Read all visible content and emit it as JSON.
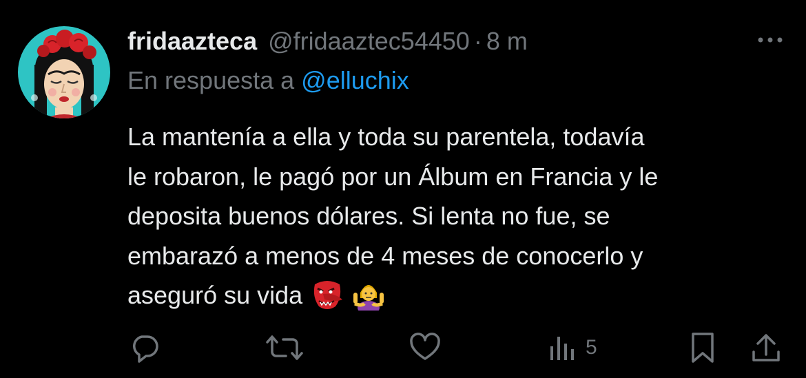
{
  "tweet": {
    "display_name": "fridaazteca",
    "handle": "@fridaaztec54450",
    "separator": "·",
    "time": "8 m",
    "reply_prefix": "En respuesta a",
    "reply_mention": "@elluchix",
    "text": "La mantenía a ella y toda su parentela, todavía\nle robaron, le pagó por un Álbum en Francia y le\ndeposita buenos dólares. Si lenta no fue, se\nembarazó a menos de 4 meses de conocerlo y\naseguró su vida",
    "emojis": [
      "tengu-mask-emoji",
      "person-shrugging-emoji"
    ],
    "avatar_icon": "frida-illustration-avatar",
    "more_icon": "more-dots-icon"
  },
  "actions": {
    "reply": {
      "icon": "reply-icon",
      "count": ""
    },
    "repost": {
      "icon": "repost-icon",
      "count": ""
    },
    "like": {
      "icon": "heart-icon",
      "count": ""
    },
    "views": {
      "icon": "views-chart-icon",
      "count": "5"
    },
    "bookmark": {
      "icon": "bookmark-icon",
      "count": ""
    },
    "share": {
      "icon": "share-icon",
      "count": ""
    }
  },
  "colors": {
    "background": "#000000",
    "primary_text": "#e7e9ea",
    "secondary_text": "#71767b",
    "link": "#1d9bf0",
    "avatar_bg": "#2ec4c4"
  }
}
